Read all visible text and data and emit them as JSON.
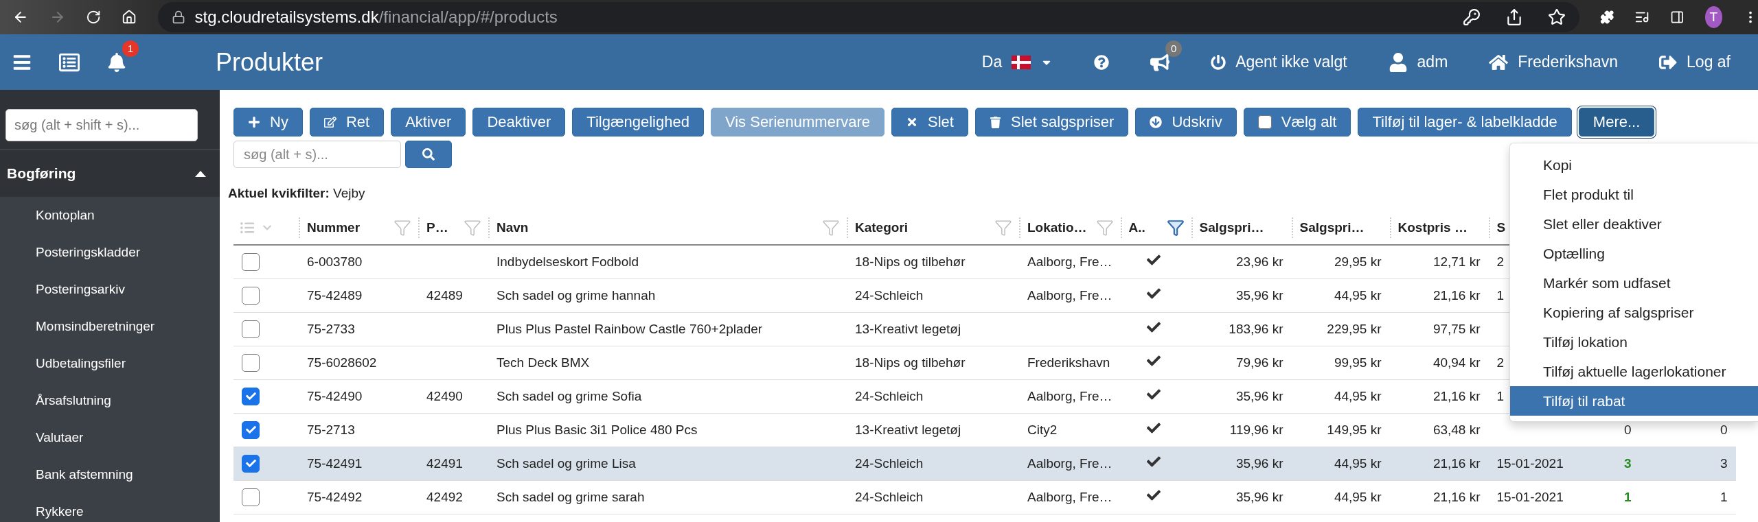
{
  "browser": {
    "forward_disabled": true,
    "url_host": "stg.cloudretailsystems.dk",
    "url_path": "/financial/app/#/products",
    "avatar": "T"
  },
  "header": {
    "notifications_badge": "1",
    "title": "Produkter",
    "language": "Da",
    "announcements_badge": "0",
    "agent": "Agent ikke valgt",
    "user": "adm",
    "location": "Frederikshavn",
    "logout": "Log af"
  },
  "sidebar": {
    "search": {
      "placeholder": "søg (alt + shift + s)..."
    },
    "section": {
      "title": "Bogføring",
      "expanded": true
    },
    "items": [
      "Kontoplan",
      "Posteringskladder",
      "Posteringsarkiv",
      "Momsindberetninger",
      "Udbetalingsfiler",
      "Årsafslutning",
      "Valutaer",
      "Bank afstemning",
      "Rykkere"
    ]
  },
  "toolbar": [
    {
      "kind": "add",
      "label": "Ny",
      "disabled": false,
      "expanded": false
    },
    {
      "kind": "edit",
      "label": "Ret",
      "disabled": false,
      "expanded": false
    },
    {
      "kind": "plain",
      "label": "Aktiver",
      "disabled": false,
      "expanded": false
    },
    {
      "kind": "plain",
      "label": "Deaktiver",
      "disabled": false,
      "expanded": false
    },
    {
      "kind": "plain",
      "label": "Tilgængelighed",
      "disabled": false,
      "expanded": false
    },
    {
      "kind": "plain",
      "label": "Vis Serienummervare",
      "disabled": true,
      "expanded": false
    },
    {
      "kind": "delete",
      "label": "Slet",
      "disabled": false,
      "expanded": false
    },
    {
      "kind": "trash",
      "label": "Slet salgspriser",
      "disabled": false,
      "expanded": false
    },
    {
      "kind": "print",
      "label": "Udskriv",
      "disabled": false,
      "expanded": false
    },
    {
      "kind": "select_all",
      "label": "Vælg alt",
      "disabled": false,
      "expanded": false,
      "checked": false
    },
    {
      "kind": "plain",
      "label": "Tilføj til lager- & labelkladde",
      "disabled": false,
      "expanded": false
    },
    {
      "kind": "plain",
      "label": "Mere...",
      "disabled": false,
      "expanded": true
    }
  ],
  "search": {
    "placeholder": "søg (alt + s)..."
  },
  "quick_filter": "**Aktuel kvikfilter:** Vejby",
  "table": {
    "columns": [
      {
        "kind": "text",
        "label": "Nummer",
        "filter_active": false
      },
      {
        "kind": "text",
        "label": "P…",
        "filter_active": false
      },
      {
        "kind": "text",
        "label": "Navn",
        "filter_active": false
      },
      {
        "kind": "text",
        "label": "Kategori",
        "filter_active": false
      },
      {
        "kind": "text",
        "label": "Lokatio…",
        "filter_active": false
      },
      {
        "kind": "check",
        "label": "A..",
        "filter_active": true
      },
      {
        "kind": "number",
        "label": "Salgspri…"
      },
      {
        "kind": "number",
        "label": "Salgspri…"
      },
      {
        "kind": "number",
        "label": "Kostpris …"
      },
      {
        "kind": "text",
        "label": "S"
      },
      {
        "kind": "qty"
      },
      {
        "kind": "number"
      }
    ],
    "rows": [
      {
        "checked": false,
        "selected": false,
        "active": true,
        "cells": [
          "6-003780",
          "",
          "Indbydelseskort Fodbold",
          "18-Nips og tilbehør",
          "Aalborg, Fre…",
          "",
          "23,96 kr",
          "29,95 kr",
          "12,71 kr",
          "2",
          "",
          ""
        ]
      },
      {
        "checked": false,
        "selected": false,
        "active": true,
        "cells": [
          "75-42489",
          "42489",
          "Sch sadel og grime hannah",
          "24-Schleich",
          "Aalborg, Fre…",
          "",
          "35,96 kr",
          "44,95 kr",
          "21,16 kr",
          "1",
          "",
          ""
        ]
      },
      {
        "checked": false,
        "selected": false,
        "active": true,
        "cells": [
          "75-2733",
          "",
          "Plus Plus Pastel Rainbow Castle 760+2plader",
          "13-Kreativt legetøj",
          "",
          "",
          "183,96 kr",
          "229,95 kr",
          "97,75 kr",
          "",
          "",
          ""
        ]
      },
      {
        "checked": false,
        "selected": false,
        "active": true,
        "cells": [
          "75-6028602",
          "",
          "Tech Deck BMX",
          "18-Nips og tilbehør",
          "Frederikshavn",
          "",
          "79,96 kr",
          "99,95 kr",
          "40,94 kr",
          "2",
          "",
          ""
        ]
      },
      {
        "checked": true,
        "selected": false,
        "active": true,
        "cells": [
          "75-42490",
          "42490",
          "Sch sadel og grime Sofia",
          "24-Schleich",
          "Aalborg, Fre…",
          "",
          "35,96 kr",
          "44,95 kr",
          "21,16 kr",
          "1",
          "",
          ""
        ]
      },
      {
        "checked": true,
        "selected": false,
        "active": true,
        "highlight": false,
        "cells": [
          "75-2713",
          "",
          "Plus Plus Basic 3i1 Police 480 Pcs",
          "13-Kreativt legetøj",
          "City2",
          "",
          "119,96 kr",
          "149,95 kr",
          "63,48 kr",
          "",
          "0",
          "0"
        ]
      },
      {
        "checked": true,
        "selected": true,
        "active": true,
        "highlight": true,
        "cells": [
          "75-42491",
          "42491",
          "Sch sadel og grime Lisa",
          "24-Schleich",
          "Aalborg, Fre…",
          "",
          "35,96 kr",
          "44,95 kr",
          "21,16 kr",
          "15-01-2021",
          "3",
          "3"
        ]
      },
      {
        "checked": false,
        "selected": false,
        "active": true,
        "highlight": true,
        "cells": [
          "75-42492",
          "42492",
          "Sch sadel og grime sarah",
          "24-Schleich",
          "Aalborg, Fre…",
          "",
          "35,96 kr",
          "44,95 kr",
          "21,16 kr",
          "15-01-2021",
          "1",
          "1"
        ]
      }
    ]
  },
  "more_menu": [
    {
      "label": "Kopi",
      "selected": false
    },
    {
      "label": "Flet produkt til",
      "selected": false
    },
    {
      "label": "Slet eller deaktiver",
      "selected": false
    },
    {
      "label": "Optælling",
      "selected": false
    },
    {
      "label": "Markér som udfaset",
      "selected": false
    },
    {
      "label": "Kopiering af salgspriser",
      "selected": false
    },
    {
      "label": "Tilføj lokation",
      "selected": false
    },
    {
      "label": "Tilføj aktuelle lagerlokationer",
      "selected": false
    },
    {
      "label": "Tilføj til rabat",
      "selected": true
    }
  ]
}
